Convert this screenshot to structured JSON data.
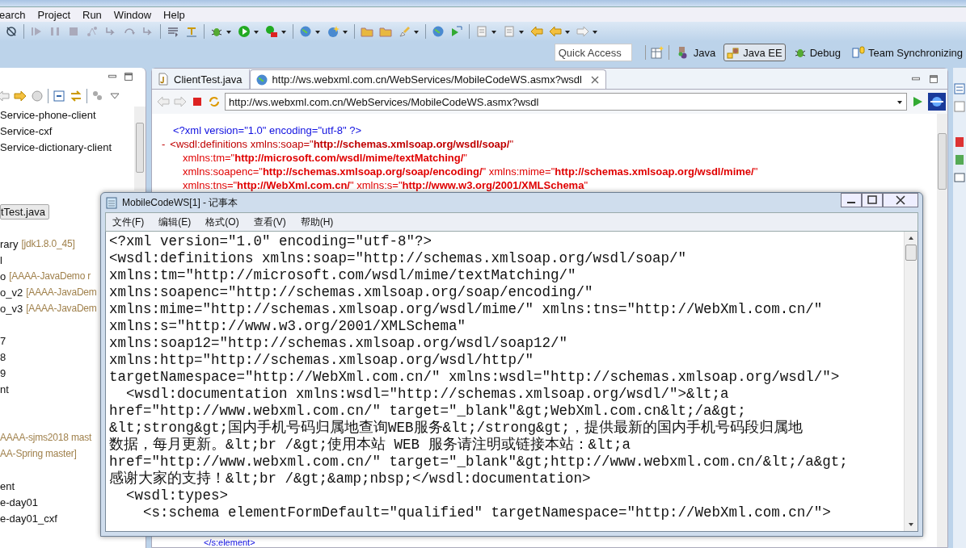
{
  "menu_bar": [
    "earch",
    "Project",
    "Run",
    "Window",
    "Help"
  ],
  "quick_access": {
    "placeholder": "Quick Access"
  },
  "perspectives": [
    {
      "label": "Java",
      "selected": false,
      "kind": "java"
    },
    {
      "label": "Java EE",
      "selected": true,
      "kind": "javaee"
    },
    {
      "label": "Debug",
      "selected": false,
      "kind": "debug"
    },
    {
      "label": "Team Synchronizing",
      "selected": false,
      "kind": "team"
    }
  ],
  "project_explorer": {
    "items": [
      {
        "text": "Service-phone-client",
        "selected": false
      },
      {
        "text": "Service-cxf",
        "selected": false
      },
      {
        "text": "Service-dictionary-client",
        "selected": false
      },
      {
        "text": "tTest.java",
        "selected": true
      },
      {
        "text": "rary",
        "decoration": "[jdk1.8.0_45]",
        "selected": false
      },
      {
        "text": "l",
        "selected": false
      },
      {
        "text": "o",
        "decoration": "[AAAA-JavaDemo r",
        "selected": false
      },
      {
        "text": "o_v2",
        "decoration": "[AAAA-JavaDem",
        "selected": false
      },
      {
        "text": "o_v3",
        "decoration": "[AAAA-JavaDem",
        "selected": false
      },
      {
        "text": "7",
        "selected": false
      },
      {
        "text": "8",
        "selected": false
      },
      {
        "text": "9",
        "selected": false
      },
      {
        "text": "nt",
        "selected": false
      },
      {
        "decoration": "AAAA-sjms2018 mast",
        "selected": false
      },
      {
        "decoration": "AA-Spring master]",
        "selected": false
      },
      {
        "text": "ent",
        "selected": false
      },
      {
        "text": "e-day01",
        "selected": false
      },
      {
        "text": "e-day01_cxf",
        "selected": false
      }
    ]
  },
  "editor": {
    "tabs": [
      {
        "label": "ClientTest.java",
        "selected": false,
        "kind": "java"
      },
      {
        "label": "http://ws.webxml.com.cn/WebServices/MobileCodeWS.asmx?wsdl",
        "selected": true,
        "kind": "web"
      }
    ],
    "address": "http://ws.webxml.com.cn/WebServices/MobileCodeWS.asmx?wsdl",
    "lines": [
      {
        "kind": "pi",
        "text": "<?xml version=\"1.0\" encoding=\"utf-8\" ?>"
      },
      {
        "kind": "open",
        "toggle": "-",
        "text": "<wsdl:definitions xmlns:soap=\"**http://schemas.xmlsoap.org/wsdl/soap/**\""
      },
      {
        "kind": "attr",
        "text": "xmlns:tm=\"**http://microsoft.com/wsdl/mime/textMatching/**\""
      },
      {
        "kind": "attr",
        "text": "xmlns:soapenc=\"**http://schemas.xmlsoap.org/soap/encoding/**\" xmlns:mime=\"**http://schemas.xmlsoap.org/wsdl/mime/**\""
      },
      {
        "kind": "attr",
        "text": "xmlns:tns=\"**http://WebXml.com.cn/**\" xmlns:s=\"**http://www.w3.org/2001/XMLSchema**\""
      }
    ],
    "bottom_line": "</s:element>"
  },
  "notepad": {
    "title": "MobileCodeWS[1] - 记事本",
    "menu": [
      "文件(F)",
      "编辑(E)",
      "格式(O)",
      "查看(V)",
      "帮助(H)"
    ],
    "lines": [
      "<?xml version=\"1.0\" encoding=\"utf-8\"?>",
      "<wsdl:definitions xmlns:soap=\"http://schemas.xmlsoap.org/wsdl/soap/\"",
      "xmlns:tm=\"http://microsoft.com/wsdl/mime/textMatching/\"",
      "xmlns:soapenc=\"http://schemas.xmlsoap.org/soap/encoding/\"",
      "xmlns:mime=\"http://schemas.xmlsoap.org/wsdl/mime/\" xmlns:tns=\"http://WebXml.com.cn/\"",
      "xmlns:s=\"http://www.w3.org/2001/XMLSchema\"",
      "xmlns:soap12=\"http://schemas.xmlsoap.org/wsdl/soap12/\"",
      "xmlns:http=\"http://schemas.xmlsoap.org/wsdl/http/\"",
      "targetNamespace=\"http://WebXml.com.cn/\" xmlns:wsdl=\"http://schemas.xmlsoap.org/wsdl/\">",
      "  <wsdl:documentation xmlns:wsdl=\"http://schemas.xmlsoap.org/wsdl/\">&lt;a",
      "href=\"http://www.webxml.com.cn/\" target=\"_blank\"&gt;WebXml.com.cn&lt;/a&gt;",
      "&lt;strong&gt;国内手机号码归属地查询WEB服务&lt;/strong&gt;，提供最新的国内手机号码段归属地",
      "数据，每月更新。&lt;br /&gt;使用本站 WEB 服务请注明或链接本站：&lt;a",
      "href=\"http://www.webxml.com.cn/\" target=\"_blank\"&gt;http://www.webxml.com.cn/&lt;/a&gt;",
      "感谢大家的支持！&lt;br /&gt;&amp;nbsp;</wsdl:documentation>",
      "  <wsdl:types>",
      "    <s:schema elementFormDefault=\"qualified\" targetNamespace=\"http://WebXml.com.cn/\">"
    ]
  }
}
